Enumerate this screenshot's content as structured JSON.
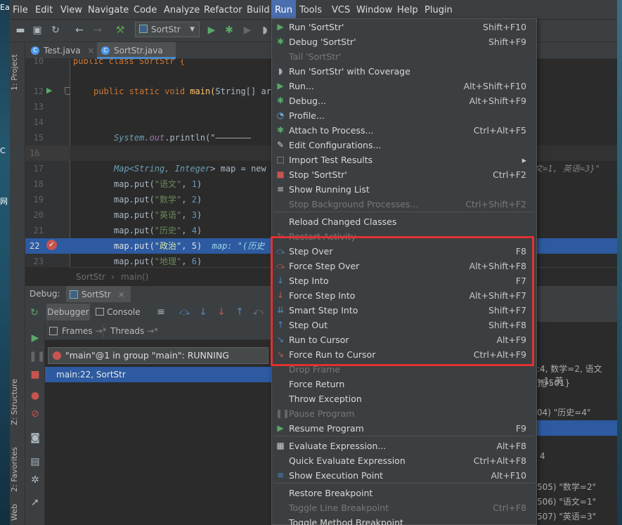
{
  "desktop": {
    "labels": [
      "Ea",
      "C",
      "网"
    ]
  },
  "menubar": [
    "File",
    "Edit",
    "View",
    "Navigate",
    "Code",
    "Analyze",
    "Refactor",
    "Build",
    "Run",
    "Tools",
    "VCS",
    "Window",
    "Help",
    "Plugin"
  ],
  "toolbar": {
    "run_config": "SortStr"
  },
  "side_tabs": {
    "project": "1: Project",
    "structure": "Z: Structure",
    "favorites": "2: Favorites",
    "web": "Web"
  },
  "editor_tabs": [
    {
      "label": "Test.java"
    },
    {
      "label": "SortStr.java"
    }
  ],
  "gutter_lines": [
    "10",
    "12",
    "13",
    "14",
    "15",
    "16",
    "17",
    "18",
    "19",
    "20",
    "21",
    "22",
    "23"
  ],
  "code": {
    "line10": "public class SortStr {",
    "line12_kw": "public static void",
    "line12_name": "main(",
    "line12_type": "String",
    "line12_rest": "[] arg",
    "line15_a": "System.",
    "line15_b": "out",
    "line15_c": ".println(\"———————",
    "line17_a": "Map<",
    "line17_b": "String, Integer",
    "line17_c": "> map = new H",
    "puts": [
      {
        "key": "\"语文\"",
        "val": "1"
      },
      {
        "key": "\"数学\"",
        "val": "2"
      },
      {
        "key": "\"英语\"",
        "val": "3"
      },
      {
        "key": "\"历史\"",
        "val": "4"
      },
      {
        "key": "\"政治\"",
        "val": "5"
      },
      {
        "key": "\"地理\"",
        "val": "6"
      }
    ],
    "put_prefix": "map.put(",
    "inline_hint": "map: \"(历史",
    "right_hint": "文=1, 英语=3}\""
  },
  "breadcrumb": {
    "cls": "SortStr",
    "method": "main()"
  },
  "debug": {
    "label": "Debug:",
    "tab": "SortStr",
    "debugger_tab": "Debugger",
    "console_tab": "Console",
    "frames": "Frames",
    "threads": "Threads",
    "thread_select": "\"main\"@1 in group \"main\": RUNNING",
    "frame_row": "main:22, SortStr"
  },
  "right_panel": {
    "line1": ":4, 数学=2, 语文=1, 英",
    "line2": "]@501}",
    "line3": "04) \"历史=4\"",
    "line4": "4",
    "line5": "505) \"数学=2\"",
    "line6": "506) \"语文=1\"",
    "line7": "507) \"英语=3\""
  },
  "run_menu": [
    {
      "label": "Run 'SortStr'",
      "shortcut": "Shift+F10",
      "icon": "run-icon",
      "disabled": false
    },
    {
      "label": "Debug 'SortStr'",
      "shortcut": "Shift+F9",
      "icon": "debug-icon",
      "disabled": false
    },
    {
      "label": "Tail 'SortStr'",
      "shortcut": "",
      "icon": "",
      "disabled": true
    },
    {
      "label": "Run 'SortStr' with Coverage",
      "shortcut": "",
      "icon": "coverage-icon",
      "disabled": false
    },
    {
      "label": "Run...",
      "shortcut": "Alt+Shift+F10",
      "icon": "run-icon",
      "disabled": false
    },
    {
      "label": "Debug...",
      "shortcut": "Alt+Shift+F9",
      "icon": "debug-icon",
      "disabled": false
    },
    {
      "label": "Profile...",
      "shortcut": "",
      "icon": "profile-icon",
      "disabled": false
    },
    {
      "label": "Attach to Process...",
      "shortcut": "Ctrl+Alt+F5",
      "icon": "attach-icon",
      "disabled": false
    },
    {
      "label": "Edit Configurations...",
      "shortcut": "",
      "icon": "edit-icon",
      "disabled": false
    },
    {
      "label": "Import Test Results",
      "shortcut": "",
      "icon": "import-icon",
      "disabled": false,
      "submenu": true
    },
    {
      "label": "Stop 'SortStr'",
      "shortcut": "Ctrl+F2",
      "icon": "stop-icon",
      "disabled": false
    },
    {
      "label": "Show Running List",
      "shortcut": "",
      "icon": "list-icon",
      "disabled": false
    },
    {
      "label": "Stop Background Processes...",
      "shortcut": "Ctrl+Shift+F2",
      "icon": "",
      "disabled": true
    },
    {
      "label": "Reload Changed Classes",
      "shortcut": "",
      "icon": "",
      "disabled": false
    },
    {
      "label": "Restart Activity",
      "shortcut": "",
      "icon": "restart-icon",
      "disabled": true
    },
    {
      "label": "Step Over",
      "shortcut": "F8",
      "icon": "step-over-icon",
      "disabled": false
    },
    {
      "label": "Force Step Over",
      "shortcut": "Alt+Shift+F8",
      "icon": "force-step-over-icon",
      "disabled": false
    },
    {
      "label": "Step Into",
      "shortcut": "F7",
      "icon": "step-into-icon",
      "disabled": false
    },
    {
      "label": "Force Step Into",
      "shortcut": "Alt+Shift+F7",
      "icon": "force-step-into-icon",
      "disabled": false
    },
    {
      "label": "Smart Step Into",
      "shortcut": "Shift+F7",
      "icon": "smart-step-into-icon",
      "disabled": false
    },
    {
      "label": "Step Out",
      "shortcut": "Shift+F8",
      "icon": "step-out-icon",
      "disabled": false
    },
    {
      "label": "Run to Cursor",
      "shortcut": "Alt+F9",
      "icon": "run-to-cursor-icon",
      "disabled": false
    },
    {
      "label": "Force Run to Cursor",
      "shortcut": "Ctrl+Alt+F9",
      "icon": "force-run-to-cursor-icon",
      "disabled": false
    },
    {
      "label": "Drop Frame",
      "shortcut": "",
      "icon": "",
      "disabled": true
    },
    {
      "label": "Force Return",
      "shortcut": "",
      "icon": "",
      "disabled": false
    },
    {
      "label": "Throw Exception",
      "shortcut": "",
      "icon": "",
      "disabled": false
    },
    {
      "label": "Pause Program",
      "shortcut": "",
      "icon": "pause-icon",
      "disabled": true
    },
    {
      "label": "Resume Program",
      "shortcut": "F9",
      "icon": "resume-icon",
      "disabled": false
    },
    {
      "label": "Evaluate Expression...",
      "shortcut": "Alt+F8",
      "icon": "evaluate-icon",
      "disabled": false
    },
    {
      "label": "Quick Evaluate Expression",
      "shortcut": "Ctrl+Alt+F8",
      "icon": "",
      "disabled": false
    },
    {
      "label": "Show Execution Point",
      "shortcut": "Alt+F10",
      "icon": "execution-point-icon",
      "disabled": false
    },
    {
      "label": "Restore Breakpoint",
      "shortcut": "",
      "icon": "",
      "disabled": false
    },
    {
      "label": "Toggle Line Breakpoint",
      "shortcut": "Ctrl+F8",
      "icon": "",
      "disabled": true
    },
    {
      "label": "Toggle Method Breakpoint",
      "shortcut": "",
      "icon": "",
      "disabled": false
    }
  ]
}
